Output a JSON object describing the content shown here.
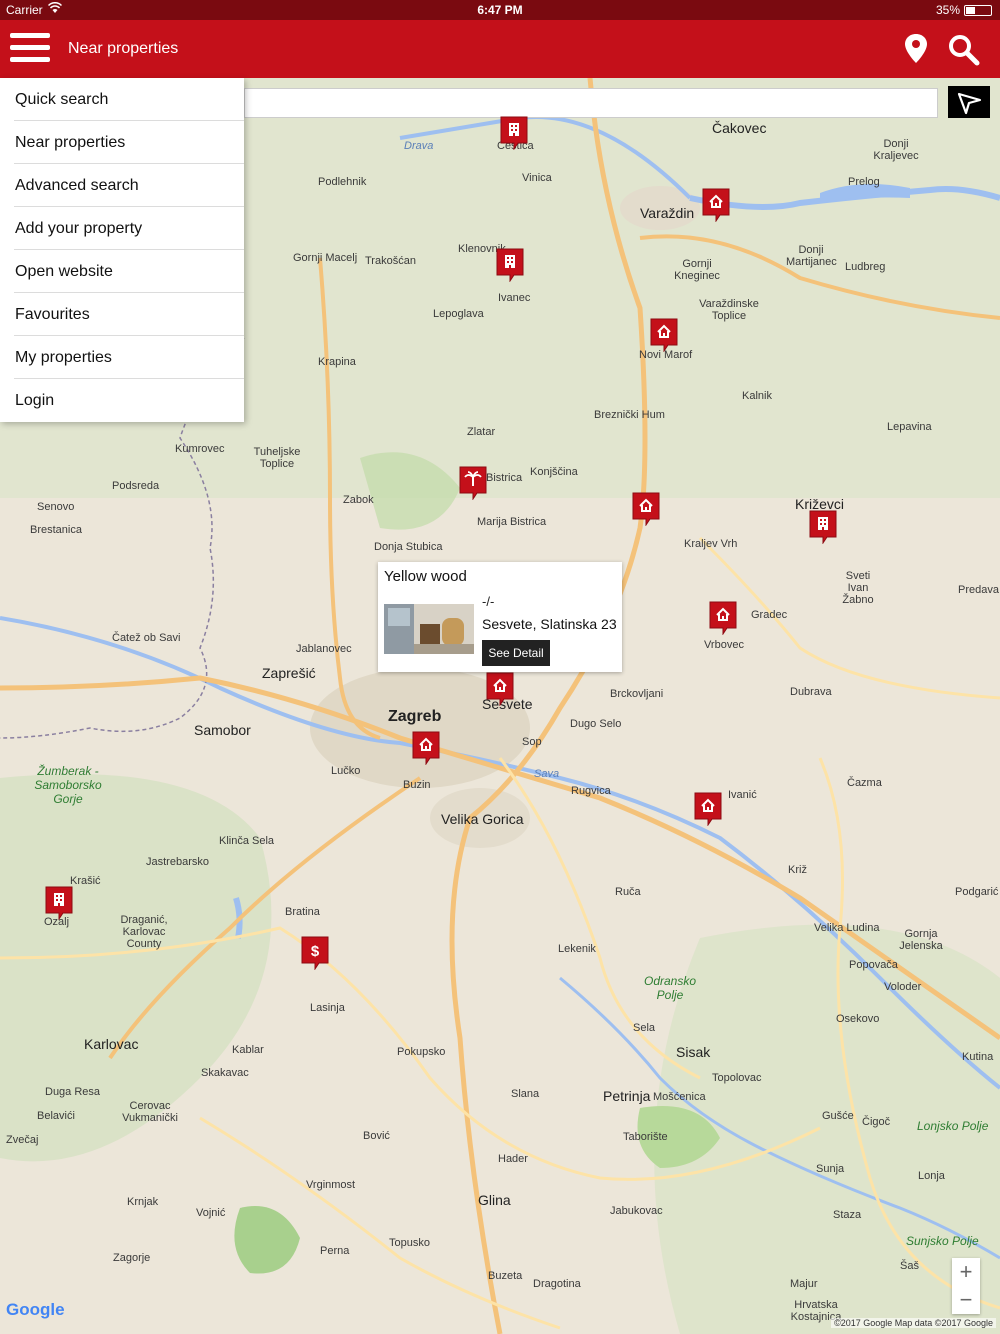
{
  "status_bar": {
    "carrier": "Carrier",
    "time": "6:47 PM",
    "battery": "35%"
  },
  "app_bar": {
    "title": "Near properties",
    "accent_color": "#c4101a"
  },
  "menu": {
    "items": [
      {
        "label": "Quick search"
      },
      {
        "label": "Near properties"
      },
      {
        "label": "Advanced search"
      },
      {
        "label": "Add your property"
      },
      {
        "label": "Open website"
      },
      {
        "label": "Favourites"
      },
      {
        "label": "My properties"
      },
      {
        "label": "Login"
      }
    ]
  },
  "info_window": {
    "name": "Yellow wood",
    "price": "-/-",
    "address": "Sesvete, Slatinska 23",
    "detail_label": "See Detail"
  },
  "map": {
    "places": [
      {
        "name": "Čakovec"
      },
      {
        "name": "Cestica"
      },
      {
        "name": "Vinica"
      },
      {
        "name": "Varaždin"
      },
      {
        "name": "Prelog"
      },
      {
        "name": "Donji Kraljevec"
      },
      {
        "name": "Podlehnik"
      },
      {
        "name": "Klenovnik"
      },
      {
        "name": "Gornji Macelj"
      },
      {
        "name": "Trakošćan"
      },
      {
        "name": "Ivanec"
      },
      {
        "name": "Lepoglava"
      },
      {
        "name": "Gornji Kneginec"
      },
      {
        "name": "Donji Martijanec"
      },
      {
        "name": "Ludbreg"
      },
      {
        "name": "Varaždinske Toplice"
      },
      {
        "name": "Novi Marof"
      },
      {
        "name": "Krapina"
      },
      {
        "name": "Kalnik"
      },
      {
        "name": "Breznički Hum"
      },
      {
        "name": "Zlatar"
      },
      {
        "name": "Lepavina"
      },
      {
        "name": "Kumrovec"
      },
      {
        "name": "Tuheljske Toplice"
      },
      {
        "name": "Podsreda"
      },
      {
        "name": "Zabok"
      },
      {
        "name": "Bistrica"
      },
      {
        "name": "Konjščina"
      },
      {
        "name": "Križevci"
      },
      {
        "name": "Marija Bistrica"
      },
      {
        "name": "Senovo"
      },
      {
        "name": "Brestanica"
      },
      {
        "name": "Donja Stubica"
      },
      {
        "name": "Kraljev Vrh"
      },
      {
        "name": "Sveti Ivan Žabno"
      },
      {
        "name": "Gradec"
      },
      {
        "name": "Čatež ob Savi"
      },
      {
        "name": "Jablanovec"
      },
      {
        "name": "Vrbovec"
      },
      {
        "name": "Zaprešić"
      },
      {
        "name": "Brckovljani"
      },
      {
        "name": "Dubrava"
      },
      {
        "name": "Samobor"
      },
      {
        "name": "Zagreb"
      },
      {
        "name": "Sesvete"
      },
      {
        "name": "Dugo Selo"
      },
      {
        "name": "Sop"
      },
      {
        "name": "Lučko"
      },
      {
        "name": "Buzin"
      },
      {
        "name": "Rugvica"
      },
      {
        "name": "Ivanić"
      },
      {
        "name": "Čazma"
      },
      {
        "name": "Velika Gorica"
      },
      {
        "name": "Klinča Sela"
      },
      {
        "name": "Jastrebarsko"
      },
      {
        "name": "Krašić"
      },
      {
        "name": "Ozalj"
      },
      {
        "name": "Ruča"
      },
      {
        "name": "Križ"
      },
      {
        "name": "Podgarić"
      },
      {
        "name": "Bratina"
      },
      {
        "name": "Pokupsko"
      },
      {
        "name": "Lekenik"
      },
      {
        "name": "Velika Ludina"
      },
      {
        "name": "Gornja Jelenska"
      },
      {
        "name": "Popovača"
      },
      {
        "name": "Voloder"
      },
      {
        "name": "Lasinja"
      },
      {
        "name": "Karlovac"
      },
      {
        "name": "Kablar"
      },
      {
        "name": "Skakavac"
      },
      {
        "name": "Sela"
      },
      {
        "name": "Sisak"
      },
      {
        "name": "Osekovo"
      },
      {
        "name": "Kutina"
      },
      {
        "name": "Duga Resa"
      },
      {
        "name": "Cerovac Vukmanički"
      },
      {
        "name": "Belavići"
      },
      {
        "name": "Slana"
      },
      {
        "name": "Petrinja"
      },
      {
        "name": "Mošćenica"
      },
      {
        "name": "Topolovac"
      },
      {
        "name": "Zvečaj"
      },
      {
        "name": "Taborište"
      },
      {
        "name": "Gušće"
      },
      {
        "name": "Čigoč"
      },
      {
        "name": "Bović"
      },
      {
        "name": "Hader"
      },
      {
        "name": "Sunja"
      },
      {
        "name": "Lonja"
      },
      {
        "name": "Vrginmost"
      },
      {
        "name": "Krnjak"
      },
      {
        "name": "Vojnić"
      },
      {
        "name": "Glina"
      },
      {
        "name": "Jabukovac"
      },
      {
        "name": "Staza"
      },
      {
        "name": "Zagorje"
      },
      {
        "name": "Perna"
      },
      {
        "name": "Topusko"
      },
      {
        "name": "Buzeta"
      },
      {
        "name": "Dragotina"
      },
      {
        "name": "Majur"
      },
      {
        "name": "Šaš"
      },
      {
        "name": "Hrvatska Kostajnica"
      },
      {
        "name": "Draganić, Karlovac County"
      },
      {
        "name": "Predava"
      },
      {
        "name": "Žumberak - Samoborsko Gorje"
      },
      {
        "name": "Odransko Polje"
      },
      {
        "name": "Lonjsko Polje"
      },
      {
        "name": "Sunjsko Polje"
      },
      {
        "name": "Drava"
      },
      {
        "name": "Sava"
      }
    ]
  },
  "zoom": {
    "in_label": "+",
    "out_label": "−"
  },
  "google_logo": "Google",
  "attribution": "©2017 Google Map data ©2017 Google",
  "markers": [
    {
      "type": "building-icon"
    },
    {
      "type": "house-icon"
    },
    {
      "type": "building-icon"
    },
    {
      "type": "house-icon"
    },
    {
      "type": "palm-icon"
    },
    {
      "type": "house-icon"
    },
    {
      "type": "building-icon"
    },
    {
      "type": "house-icon"
    },
    {
      "type": "house-icon"
    },
    {
      "type": "house-icon"
    },
    {
      "type": "house-icon"
    },
    {
      "type": "building-icon"
    },
    {
      "type": "dollar-icon"
    }
  ]
}
